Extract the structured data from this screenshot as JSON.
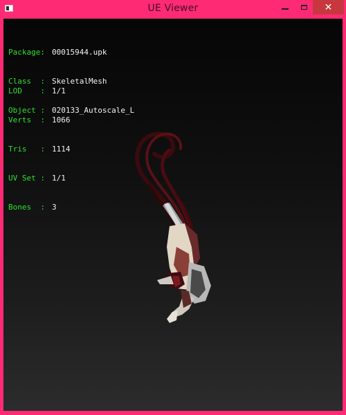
{
  "window": {
    "title": "UE Viewer",
    "close_glyph": "✕"
  },
  "info": {
    "package": {
      "label": "Package:",
      "value": "00015944.upk"
    },
    "class": {
      "label": "Class  :",
      "value": "SkeletalMesh"
    },
    "object": {
      "label": "Object :",
      "value": "020133_Autoscale_L"
    },
    "lod": {
      "label": "LOD    :",
      "value": "1/1"
    },
    "verts": {
      "label": "Verts  :",
      "value": "1066"
    },
    "tris": {
      "label": "Tris   :",
      "value": "1114"
    },
    "uvset": {
      "label": "UV Set :",
      "value": "1/1"
    },
    "bones": {
      "label": "Bones  :",
      "value": "3"
    }
  },
  "colors": {
    "frame": "#ff2a74",
    "close_button": "#c7383e",
    "label_text": "#2fe02f",
    "value_text": "#f2f2f2"
  },
  "icons": {
    "app": "app-window-icon",
    "minimize": "minimize-icon",
    "maximize": "maximize-icon",
    "close": "close-icon"
  }
}
